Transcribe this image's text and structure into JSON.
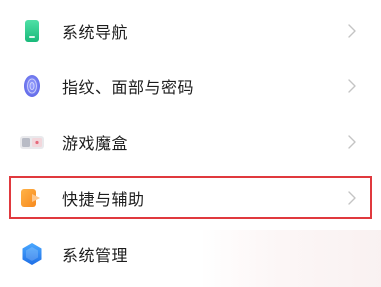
{
  "settings": {
    "items": [
      {
        "label": "系统导航",
        "icon": "system-navigation-icon"
      },
      {
        "label": "指纹、面部与密码",
        "icon": "fingerprint-icon"
      },
      {
        "label": "游戏魔盒",
        "icon": "game-box-icon"
      },
      {
        "label": "快捷与辅助",
        "icon": "shortcut-assist-icon",
        "highlighted": true
      },
      {
        "label": "系统管理",
        "icon": "system-management-icon"
      }
    ]
  },
  "colors": {
    "highlight_border": "#e0393e",
    "chevron": "#c4c4c4",
    "text": "#1d1d1d"
  }
}
